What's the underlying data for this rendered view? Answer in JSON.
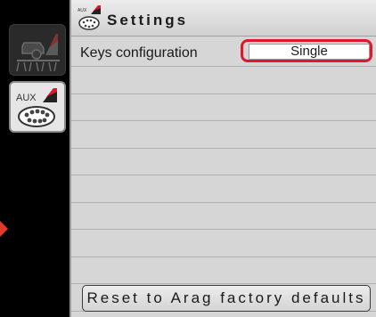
{
  "header": {
    "title": "Settings",
    "icon": "aux-keypad-icon"
  },
  "sidebar": {
    "items": [
      {
        "name": "sprayer-function-icon",
        "active": false
      },
      {
        "name": "aux-keypad-icon",
        "label": "AUX",
        "active": true
      }
    ]
  },
  "settings": {
    "rows": [
      {
        "label": "Keys configuration",
        "value": "Single"
      }
    ],
    "empty_row_count": 9
  },
  "footer": {
    "reset_label": "Reset to Arag factory defaults"
  },
  "colors": {
    "highlight": "#e0182b",
    "accent_arrow": "#e23a2a",
    "panel_bg": "#d6d6d6"
  }
}
